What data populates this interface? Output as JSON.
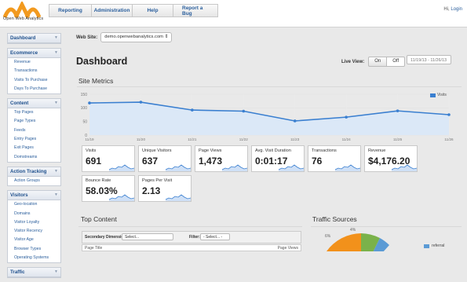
{
  "app": {
    "logo_text": "Open Web Analytics"
  },
  "nav": [
    {
      "label": "Reporting"
    },
    {
      "label": "Administration"
    },
    {
      "label": "Help"
    },
    {
      "label": "Report a Bug"
    }
  ],
  "user": {
    "greeting": "Hi, ",
    "login_label": "Login"
  },
  "sidebar": {
    "dashboard": "Dashboard",
    "sections": [
      {
        "title": "Ecommerce",
        "items": [
          "Revenue",
          "Transactions",
          "Visits To Purchase",
          "Days To Purchase"
        ]
      },
      {
        "title": "Content",
        "items": [
          "Top Pages",
          "Page Types",
          "Feeds",
          "Entry Pages",
          "Exit Pages",
          "Domstreams"
        ]
      },
      {
        "title": "Action Tracking",
        "items": [
          "Action Groups"
        ]
      },
      {
        "title": "Visitors",
        "items": [
          "Geo-location",
          "Domains",
          "Visitor Loyalty",
          "Visitor Recency",
          "Visitor Age",
          "Browser Types",
          "Operating Systems"
        ]
      },
      {
        "title": "Traffic",
        "items": []
      }
    ]
  },
  "website": {
    "label": "Web Site:",
    "value": "demo.openwebanalytics.com"
  },
  "dashboard": {
    "title": "Dashboard",
    "live_view_label": "Live View:",
    "toggle_on": "On",
    "toggle_off": "Off",
    "date_range": "11/19/13 - 11/26/13"
  },
  "site_metrics": {
    "title": "Site Metrics",
    "legend": "Visits"
  },
  "chart_data": {
    "type": "area",
    "categories": [
      "11/19",
      "11/20",
      "11/21",
      "11/22",
      "11/23",
      "11/24",
      "11/25",
      "11/26"
    ],
    "series": [
      {
        "name": "Visits",
        "values": [
          118,
          121,
          92,
          88,
          52,
          66,
          89,
          75
        ]
      }
    ],
    "ylim": [
      0,
      150
    ],
    "yticks": [
      0,
      50,
      100,
      150
    ],
    "grid": true,
    "legend_position": "top-right",
    "color": "#3a7fd0"
  },
  "cards": [
    {
      "label": "Visits",
      "value": "691"
    },
    {
      "label": "Unique Visitors",
      "value": "637"
    },
    {
      "label": "Page Views",
      "value": "1,473"
    },
    {
      "label": "Avg. Visit Duration",
      "value": "0:01:17"
    },
    {
      "label": "Transactions",
      "value": "76"
    },
    {
      "label": "Revenue",
      "value": "$4,176.20"
    },
    {
      "label": "Bounce Rate",
      "value": "58.03%"
    },
    {
      "label": "Pages Per Visit",
      "value": "2.13"
    }
  ],
  "top_content": {
    "title": "Top Content",
    "secondary_label": "Secondary Dimension:",
    "secondary_value": "Select...",
    "filter_label": "Filter:",
    "filter_value": "- Select... -",
    "col_page_title": "Page Title",
    "col_page_views": "Page Views"
  },
  "traffic_sources": {
    "title": "Traffic Sources",
    "pct_a": "6%",
    "pct_b": "4%",
    "legend_referral": "referral"
  }
}
